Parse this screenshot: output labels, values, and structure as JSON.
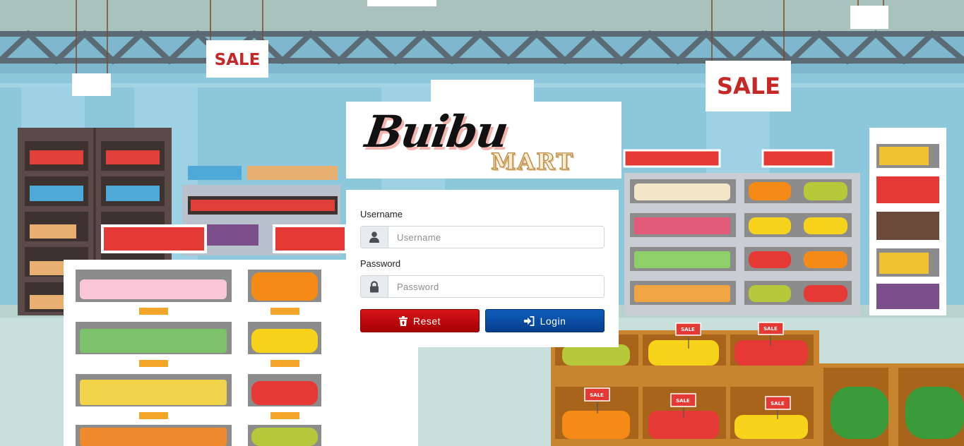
{
  "background": {
    "signs": [
      "SALE",
      "SALE"
    ],
    "price_tags": [
      "SALE",
      "SALE",
      "SALE",
      "SALE",
      "SALE"
    ]
  },
  "logo": {
    "brand": "Buibu",
    "sub": "MART"
  },
  "form": {
    "username_label": "Username",
    "username_placeholder": "Username",
    "username_icon": "user-icon",
    "password_label": "Password",
    "password_placeholder": "Password",
    "password_icon": "lock-icon",
    "reset_label": "Reset",
    "reset_icon": "trash-icon",
    "login_label": "Login",
    "login_icon": "sign-in-icon"
  },
  "colors": {
    "reset": "#c1070c",
    "login": "#0a4fa3",
    "sale_sign_text": "#c62828"
  }
}
